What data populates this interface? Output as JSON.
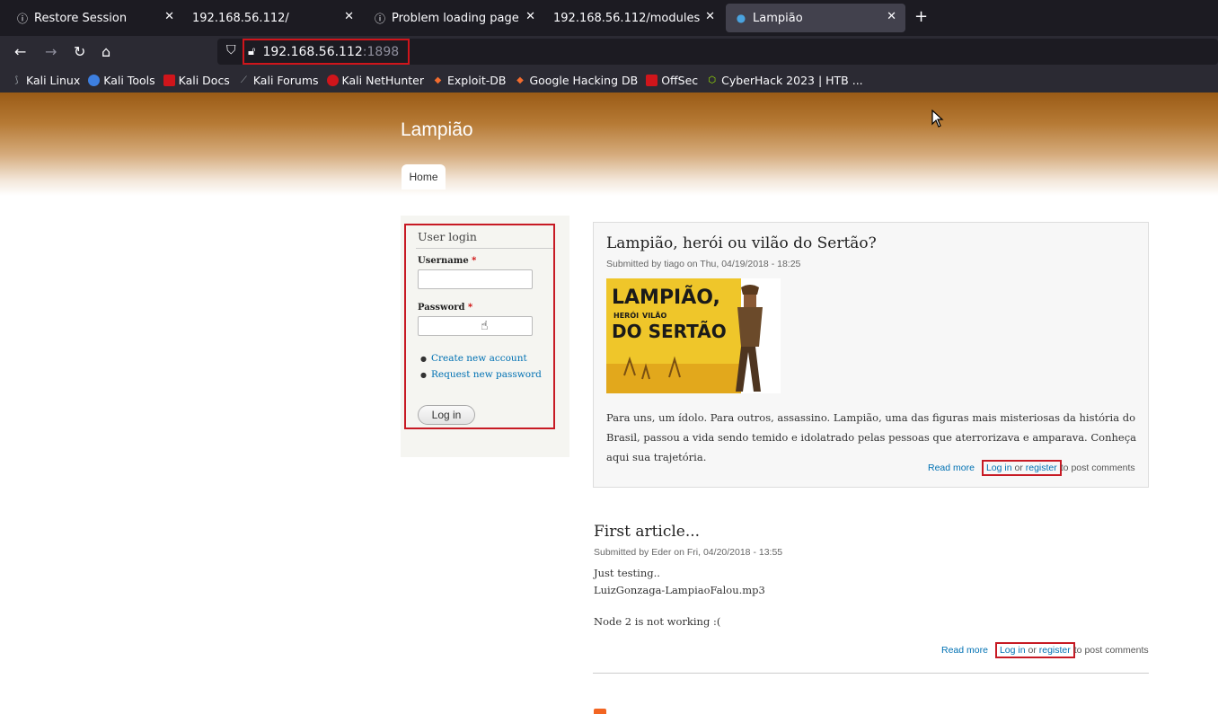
{
  "browser": {
    "tabs": [
      {
        "title": "Restore Session",
        "icon": "info-circle-icon"
      },
      {
        "title": "192.168.56.112/",
        "icon": ""
      },
      {
        "title": "Problem loading page",
        "icon": "info-circle-icon"
      },
      {
        "title": "192.168.56.112/modules",
        "icon": ""
      },
      {
        "title": "Lampião",
        "icon": "drupal-favicon-icon",
        "active": true
      }
    ],
    "url_host": "192.168.56.112",
    "url_port": ":1898",
    "bookmarks": [
      {
        "label": "Kali Linux",
        "icon": "kali-dragon-icon",
        "color": "#4a90e2"
      },
      {
        "label": "Kali Tools",
        "icon": "kali-tools-icon",
        "color": "#3d7fe0"
      },
      {
        "label": "Kali Docs",
        "icon": "kali-docs-icon",
        "color": "#d0151b"
      },
      {
        "label": "Kali Forums",
        "icon": "kali-forums-icon",
        "color": "#9aa0a6"
      },
      {
        "label": "Kali NetHunter",
        "icon": "nethunter-icon",
        "color": "#d0151b"
      },
      {
        "label": "Exploit-DB",
        "icon": "exploitdb-icon",
        "color": "#f26c2f"
      },
      {
        "label": "Google Hacking DB",
        "icon": "ghdb-icon",
        "color": "#f26c2f"
      },
      {
        "label": "OffSec",
        "icon": "offsec-icon",
        "color": "#d0151b"
      },
      {
        "label": "CyberHack 2023 | HTB ...",
        "icon": "htb-cube-icon",
        "color": "#9fef00"
      }
    ]
  },
  "site": {
    "name": "Lampião",
    "nav_home": "Home"
  },
  "login": {
    "title": "User login",
    "username_label": "Username",
    "password_label": "Password",
    "required_mark": "*",
    "create_account": "Create new account",
    "request_password": "Request new password",
    "submit": "Log in"
  },
  "articles": [
    {
      "title": "Lampião, herói ou vilão do Sertão?",
      "meta": "Submitted by tiago on Thu, 04/19/2018 - 18:25",
      "image_text_1": "LAMPIÃO,",
      "image_text_2": "HERÓI",
      "image_text_3": "VILÃO",
      "image_text_4": "DO SERTÃO",
      "body": "Para uns, um ídolo. Para outros, assassino. Lampião, uma das figuras mais misteriosas da história do Brasil, passou a vida sendo temido e idolatrado pelas pessoas que aterrorizava e amparava. Conheça aqui sua trajetória.",
      "read_more": "Read more",
      "log_in": "Log in",
      "or": "or",
      "register": "register",
      "post_comments": "to post comments"
    },
    {
      "title": "First article...",
      "meta": "Submitted by Eder on Fri, 04/20/2018 - 13:55",
      "body_line1": "Just testing..",
      "body_line2": "LuizGonzaga-LampiaoFalou.mp3",
      "body_line3": "Node 2 is not working :(",
      "read_more": "Read more",
      "log_in": "Log in",
      "or": "or",
      "register": "register",
      "post_comments": "to post comments"
    }
  ]
}
